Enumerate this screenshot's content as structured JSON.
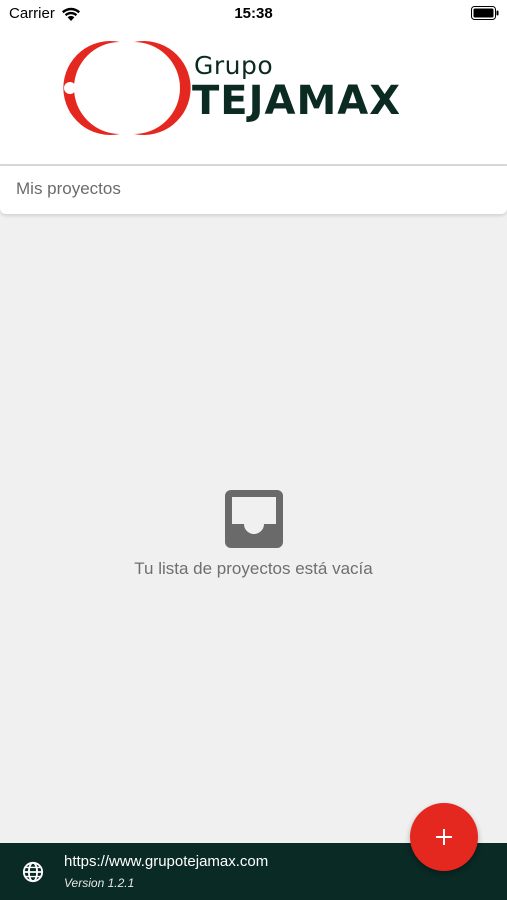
{
  "status_bar": {
    "carrier": "Carrier",
    "time": "15:38"
  },
  "header": {
    "logo_line1": "Grupo",
    "logo_line2": "TEJAMAX"
  },
  "projects": {
    "title": "Mis proyectos",
    "empty_message": "Tu lista de proyectos está vacía"
  },
  "footer": {
    "url": "https://www.grupotejamax.com",
    "version": "Version 1.2.1"
  },
  "icons": {
    "status": [
      "wifi-icon",
      "battery-icon"
    ],
    "empty": "inbox-icon",
    "footer": "globe-icon",
    "fab": "plus-icon"
  },
  "colors": {
    "brand_red": "#e42820",
    "brand_dark": "#0a2a25",
    "background": "#f0f0f0"
  }
}
